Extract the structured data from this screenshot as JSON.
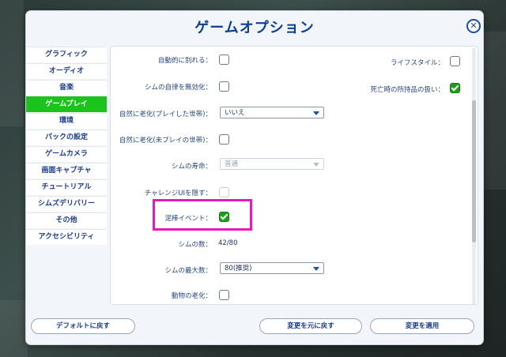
{
  "dialog": {
    "title": "ゲームオプション"
  },
  "sidebar": {
    "items": [
      {
        "label": "グラフィック",
        "active": false
      },
      {
        "label": "オーディオ",
        "active": false
      },
      {
        "label": "音楽",
        "active": false
      },
      {
        "label": "ゲームプレイ",
        "active": true
      },
      {
        "label": "環境",
        "active": false
      },
      {
        "label": "パックの設定",
        "active": false
      },
      {
        "label": "ゲームカメラ",
        "active": false
      },
      {
        "label": "画面キャプチャ",
        "active": false
      },
      {
        "label": "チュートリアル",
        "active": false
      },
      {
        "label": "シムズデリバリー",
        "active": false
      },
      {
        "label": "その他",
        "active": false
      },
      {
        "label": "アクセシビリティ",
        "active": false
      }
    ]
  },
  "gameplay": {
    "auto_breakup": {
      "label": "自動的に別れる：",
      "checked": false
    },
    "disable_autonomy": {
      "label": "シムの自律を無効化：",
      "checked": false
    },
    "aging_played": {
      "label": "自然に老化(プレイした世帯)：",
      "value": "いいえ"
    },
    "aging_unplayed": {
      "label": "自然に老化(未プレイの世帯)：",
      "checked": false
    },
    "lifespan": {
      "label": "シムの寿命：",
      "value": "普通"
    },
    "hide_challenge_ui": {
      "label": "チャレンジUIを隠す：",
      "checked": false
    },
    "burglar_event": {
      "label": "泥棒イベント：",
      "checked": true
    },
    "sim_count": {
      "label": "シムの数：",
      "value": "42/80"
    },
    "max_sims": {
      "label": "シムの最大数：",
      "value": "80(推奨)"
    },
    "pet_aging": {
      "label": "動物の老化：",
      "checked": false
    },
    "lifestyle": {
      "label": "ライフスタイル：",
      "checked": false
    },
    "death_inventory": {
      "label": "死亡時の所持品の扱い：",
      "checked": true
    }
  },
  "footer": {
    "reset_default": "デフォルトに戻す",
    "revert": "変更を元に戻す",
    "apply": "変更を適用"
  },
  "colors": {
    "accent": "#1cc31c",
    "title": "#0c3f93",
    "highlight": "#e21bbd"
  }
}
